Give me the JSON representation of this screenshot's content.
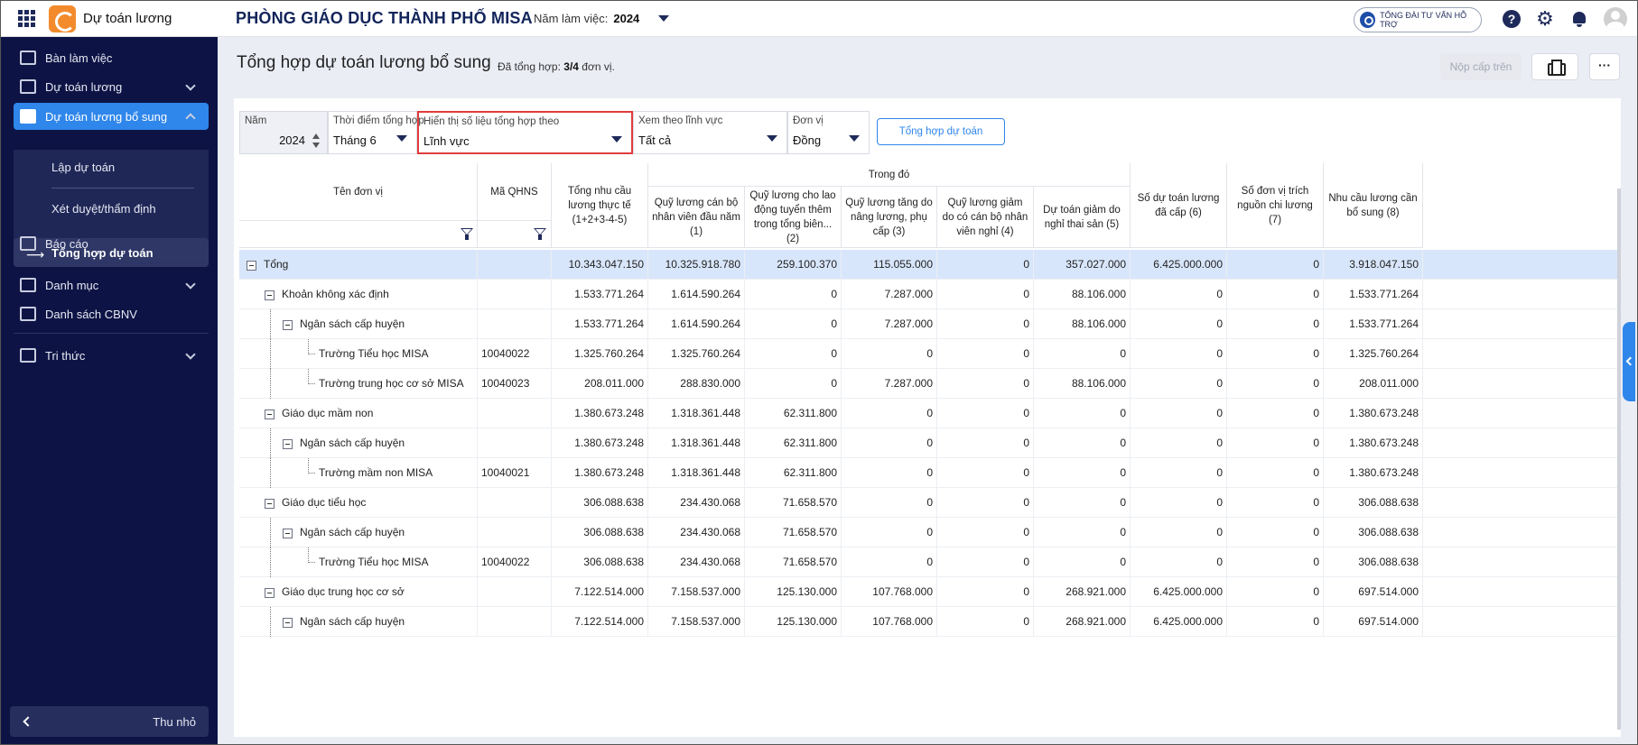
{
  "app": {
    "name": "Dự toán lương",
    "org": "PHÒNG GIÁO DỤC THÀNH PHỐ MISA",
    "year_label": "Năm làm việc:",
    "year_value": "2024",
    "hotline": "TỔNG ĐÀI TƯ VẤN HỖ TRỢ"
  },
  "sidebar": {
    "items": [
      {
        "label": "Bàn làm việc"
      },
      {
        "label": "Dự toán lương"
      },
      {
        "label": "Dự toán lương bổ sung"
      },
      {
        "label": "Báo cáo"
      },
      {
        "label": "Danh mục"
      },
      {
        "label": "Danh sách CBNV"
      },
      {
        "label": "Tri thức"
      }
    ],
    "sub_items": [
      {
        "label": "Lập dự toán"
      },
      {
        "label": "Xét duyệt/thẩm định"
      },
      {
        "label": "Tổng hợp dự toán"
      }
    ],
    "collapse_label": "Thu nhỏ"
  },
  "page": {
    "title": "Tổng hợp dự toán lương bổ sung",
    "summary_prefix": "Đã tổng hợp:",
    "summary_value": "3/4",
    "summary_suffix": "đơn vị.",
    "submit_label": "Nộp cấp trên",
    "more_label": "···"
  },
  "filters": {
    "year": {
      "label": "Năm",
      "value": "2024"
    },
    "period": {
      "label": "Thời điểm tổng hợp",
      "value": "Tháng 6"
    },
    "display_by": {
      "label": "Hiển thị số liệu tổng hợp theo",
      "value": "Lĩnh vực"
    },
    "field": {
      "label": "Xem theo lĩnh vực",
      "value": "Tất cả"
    },
    "unit": {
      "label": "Đơn vị",
      "value": "Đồng"
    },
    "aggregate_button": "Tổng hợp dự toán"
  },
  "table": {
    "headers": {
      "name": "Tên đơn vị",
      "code": "Mã QHNS",
      "total": "Tổng nhu cầu lương thực tế (1+2+3-4-5)",
      "group": "Trong đó",
      "c1": "Quỹ lương cán bộ nhân viên đầu năm (1)",
      "c2": "Quỹ lương cho lao động tuyển thêm trong tổng biên... (2)",
      "c3": "Quỹ lương tăng do nâng lương, phụ cấp (3)",
      "c4": "Quỹ lương giảm do có cán bộ nhân viên nghỉ (4)",
      "c5": "Dự toán giảm do nghỉ thai sản (5)",
      "c6": "Số dự toán lương đã cấp (6)",
      "c7": "Số đơn vị trích nguồn chi lương (7)",
      "c8": "Nhu cầu lương cần bổ sung (8)"
    },
    "rows": [
      {
        "level": 0,
        "toggle": true,
        "name": "Tổng",
        "code": "",
        "total": "10.343.047.150",
        "c1": "10.325.918.780",
        "c2": "259.100.370",
        "c3": "115.055.000",
        "c4": "0",
        "c5": "357.027.000",
        "c6": "6.425.000.000",
        "c7": "0",
        "c8": "3.918.047.150"
      },
      {
        "level": 1,
        "toggle": true,
        "name": "Khoản không xác định",
        "code": "",
        "total": "1.533.771.264",
        "c1": "1.614.590.264",
        "c2": "0",
        "c3": "7.287.000",
        "c4": "0",
        "c5": "88.106.000",
        "c6": "0",
        "c7": "0",
        "c8": "1.533.771.264"
      },
      {
        "level": 2,
        "toggle": true,
        "name": "Ngân sách cấp huyện",
        "code": "",
        "total": "1.533.771.264",
        "c1": "1.614.590.264",
        "c2": "0",
        "c3": "7.287.000",
        "c4": "0",
        "c5": "88.106.000",
        "c6": "0",
        "c7": "0",
        "c8": "1.533.771.264"
      },
      {
        "level": 3,
        "toggle": false,
        "name": "Trường Tiểu học MISA",
        "code": "10040022",
        "total": "1.325.760.264",
        "c1": "1.325.760.264",
        "c2": "0",
        "c3": "0",
        "c4": "0",
        "c5": "0",
        "c6": "0",
        "c7": "0",
        "c8": "1.325.760.264"
      },
      {
        "level": 3,
        "toggle": false,
        "name": "Trường trung học cơ sở MISA",
        "code": "10040023",
        "total": "208.011.000",
        "c1": "288.830.000",
        "c2": "0",
        "c3": "7.287.000",
        "c4": "0",
        "c5": "88.106.000",
        "c6": "0",
        "c7": "0",
        "c8": "208.011.000"
      },
      {
        "level": 1,
        "toggle": true,
        "name": "Giáo dục mầm non",
        "code": "",
        "total": "1.380.673.248",
        "c1": "1.318.361.448",
        "c2": "62.311.800",
        "c3": "0",
        "c4": "0",
        "c5": "0",
        "c6": "0",
        "c7": "0",
        "c8": "1.380.673.248"
      },
      {
        "level": 2,
        "toggle": true,
        "name": "Ngân sách cấp huyện",
        "code": "",
        "total": "1.380.673.248",
        "c1": "1.318.361.448",
        "c2": "62.311.800",
        "c3": "0",
        "c4": "0",
        "c5": "0",
        "c6": "0",
        "c7": "0",
        "c8": "1.380.673.248"
      },
      {
        "level": 3,
        "toggle": false,
        "name": "Trường mầm non MISA",
        "code": "10040021",
        "total": "1.380.673.248",
        "c1": "1.318.361.448",
        "c2": "62.311.800",
        "c3": "0",
        "c4": "0",
        "c5": "0",
        "c6": "0",
        "c7": "0",
        "c8": "1.380.673.248"
      },
      {
        "level": 1,
        "toggle": true,
        "name": "Giáo dục tiểu học",
        "code": "",
        "total": "306.088.638",
        "c1": "234.430.068",
        "c2": "71.658.570",
        "c3": "0",
        "c4": "0",
        "c5": "0",
        "c6": "0",
        "c7": "0",
        "c8": "306.088.638"
      },
      {
        "level": 2,
        "toggle": true,
        "name": "Ngân sách cấp huyện",
        "code": "",
        "total": "306.088.638",
        "c1": "234.430.068",
        "c2": "71.658.570",
        "c3": "0",
        "c4": "0",
        "c5": "0",
        "c6": "0",
        "c7": "0",
        "c8": "306.088.638"
      },
      {
        "level": 3,
        "toggle": false,
        "name": "Trường Tiểu học MISA",
        "code": "10040022",
        "total": "306.088.638",
        "c1": "234.430.068",
        "c2": "71.658.570",
        "c3": "0",
        "c4": "0",
        "c5": "0",
        "c6": "0",
        "c7": "0",
        "c8": "306.088.638"
      },
      {
        "level": 1,
        "toggle": true,
        "name": "Giáo dục trung học cơ sở",
        "code": "",
        "total": "7.122.514.000",
        "c1": "7.158.537.000",
        "c2": "125.130.000",
        "c3": "107.768.000",
        "c4": "0",
        "c5": "268.921.000",
        "c6": "6.425.000.000",
        "c7": "0",
        "c8": "697.514.000"
      },
      {
        "level": 2,
        "toggle": true,
        "name": "Ngân sách cấp huyện",
        "code": "",
        "total": "7.122.514.000",
        "c1": "7.158.537.000",
        "c2": "125.130.000",
        "c3": "107.768.000",
        "c4": "0",
        "c5": "268.921.000",
        "c6": "6.425.000.000",
        "c7": "0",
        "c8": "697.514.000"
      }
    ]
  }
}
